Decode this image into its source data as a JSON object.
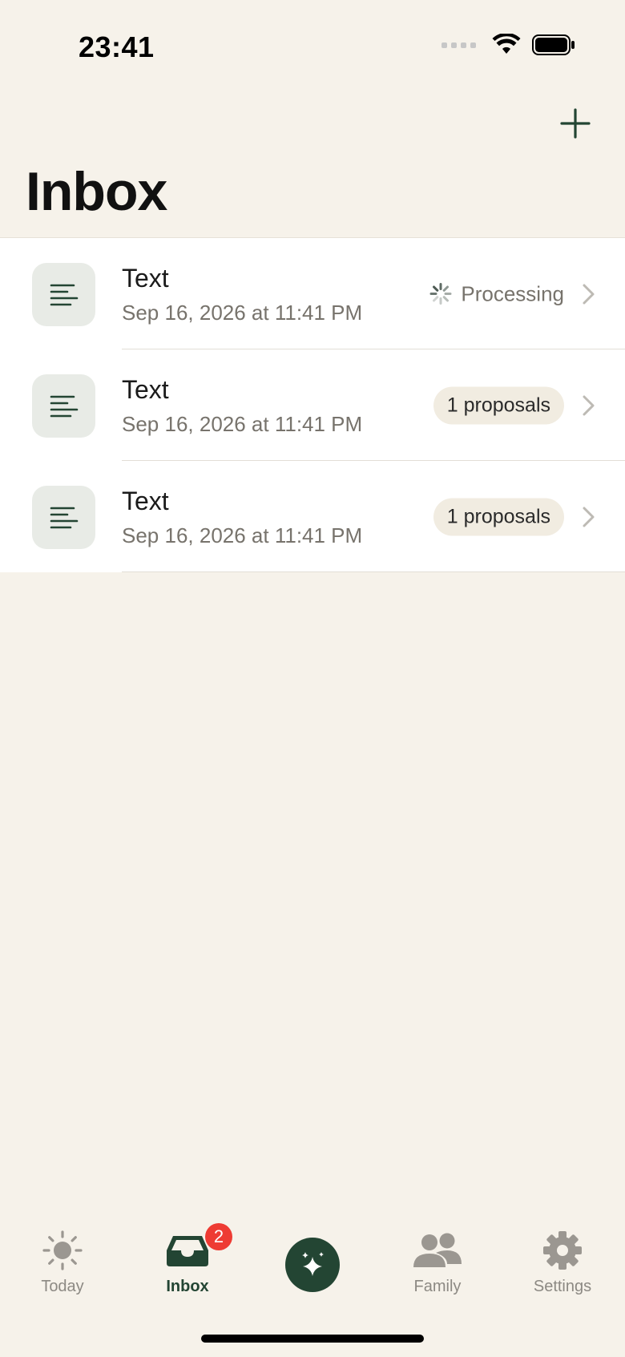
{
  "status_bar": {
    "time": "23:41"
  },
  "header": {
    "title": "Inbox",
    "add_icon": "plus-icon"
  },
  "items": [
    {
      "title": "Text",
      "date": "Sep 16, 2026 at 11:41 PM",
      "status": "Processing",
      "status_type": "processing"
    },
    {
      "title": "Text",
      "date": "Sep 16, 2026 at 11:41 PM",
      "status": "1 proposals",
      "status_type": "badge"
    },
    {
      "title": "Text",
      "date": "Sep 16, 2026 at 11:41 PM",
      "status": "1 proposals",
      "status_type": "badge"
    }
  ],
  "tabs": [
    {
      "label": "Today",
      "icon": "sun-icon",
      "active": false
    },
    {
      "label": "Inbox",
      "icon": "inbox-tray-icon",
      "active": true,
      "badge": "2"
    },
    {
      "label": "",
      "icon": "sparkle-icon",
      "active": false
    },
    {
      "label": "Family",
      "icon": "people-icon",
      "active": false
    },
    {
      "label": "Settings",
      "icon": "gear-icon",
      "active": false
    }
  ],
  "colors": {
    "background": "#f6f2ea",
    "accent": "#234533",
    "badge": "#ee3b33"
  }
}
